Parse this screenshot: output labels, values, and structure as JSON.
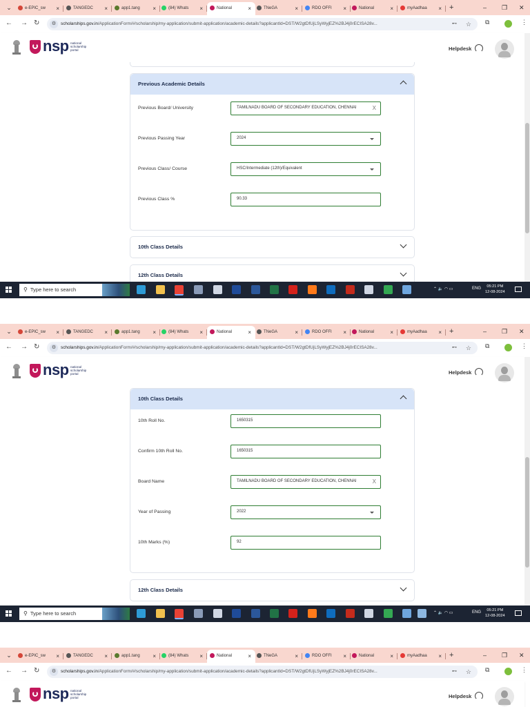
{
  "browser": {
    "tabs": [
      {
        "label": "e-EPIC_sw",
        "icon": "gmail-icon",
        "color": "#d44638",
        "active": false
      },
      {
        "label": "TANGEDC",
        "icon": "globe-icon",
        "color": "#555555",
        "active": false
      },
      {
        "label": "app1.tang",
        "icon": "gear-icon",
        "color": "#5a7a2e",
        "active": false
      },
      {
        "label": "(84) Whats",
        "icon": "whatsapp-icon",
        "color": "#25d366",
        "active": false
      },
      {
        "label": "National",
        "icon": "nsp-icon",
        "color": "#c2185b",
        "active": true
      },
      {
        "label": "TNeGA",
        "icon": "globe-icon",
        "color": "#555555",
        "active": false
      },
      {
        "label": "RDO OFFI",
        "icon": "google-icon",
        "color": "#4285f4",
        "active": false
      },
      {
        "label": "National",
        "icon": "nsp-icon",
        "color": "#c2185b",
        "active": false
      },
      {
        "label": "myAadhaa",
        "icon": "aadhaar-icon",
        "color": "#e53935",
        "active": false
      }
    ],
    "url_domain": "scholarships.gov.in",
    "url_path": "/ApplicationForm/#/scholarship/my-application/submit-application/academic-details?applicantId=DST/W2gtDfUjLSyWyjEZ%2BJ4j0rECISA28v...",
    "new_tab_symbol": "+",
    "window_controls": [
      "–",
      "❐",
      "✕"
    ]
  },
  "header": {
    "logo_text": "nsp",
    "logo_sub": [
      "national",
      "scholarship",
      "portal"
    ],
    "helpdesk": "Helpdesk"
  },
  "screen1": {
    "section_title": "Previous Academic Details",
    "fields": [
      {
        "label": "Previous Board/ University",
        "value": "TAMILNADU BOARD OF SECONDARY EDUCATION, CHENNAI",
        "control": "clearable"
      },
      {
        "label": "Previous Passing Year",
        "value": "2024",
        "control": "select"
      },
      {
        "label": "Previous Class/ Course",
        "value": "HSC/Intermediate (12th)/Equivalent",
        "control": "select"
      },
      {
        "label": "Previous Class %",
        "value": "90.33",
        "control": "text"
      }
    ],
    "collapsed": [
      "10th Class Details",
      "12th Class Details"
    ]
  },
  "screen2": {
    "section_title": "10th Class Details",
    "fields": [
      {
        "label": "10th Roll No.",
        "value": "1650315",
        "control": "text"
      },
      {
        "label": "Confirm 10th Roll No.",
        "value": "1650315",
        "control": "text"
      },
      {
        "label": "Board Name",
        "value": "TAMILNADU BOARD OF SECONDARY EDUCATION, CHENNAI",
        "control": "clearable"
      },
      {
        "label": "Year of Passing",
        "value": "2022",
        "control": "select"
      },
      {
        "label": "10th Marks (%)",
        "value": "92",
        "control": "text"
      }
    ],
    "collapsed": [
      "12th Class Details"
    ]
  },
  "taskbar": {
    "search_placeholder": "Type here to search",
    "tray_lang": "ENG",
    "time": "05:21 PM",
    "date": "12-08-2024"
  },
  "colors": {
    "tab_strip": "#f9d7cf",
    "section_header": "#d7e4f8",
    "field_border": "#2e7d32",
    "taskbar": "#1c2433",
    "brand": "#c2185b"
  }
}
